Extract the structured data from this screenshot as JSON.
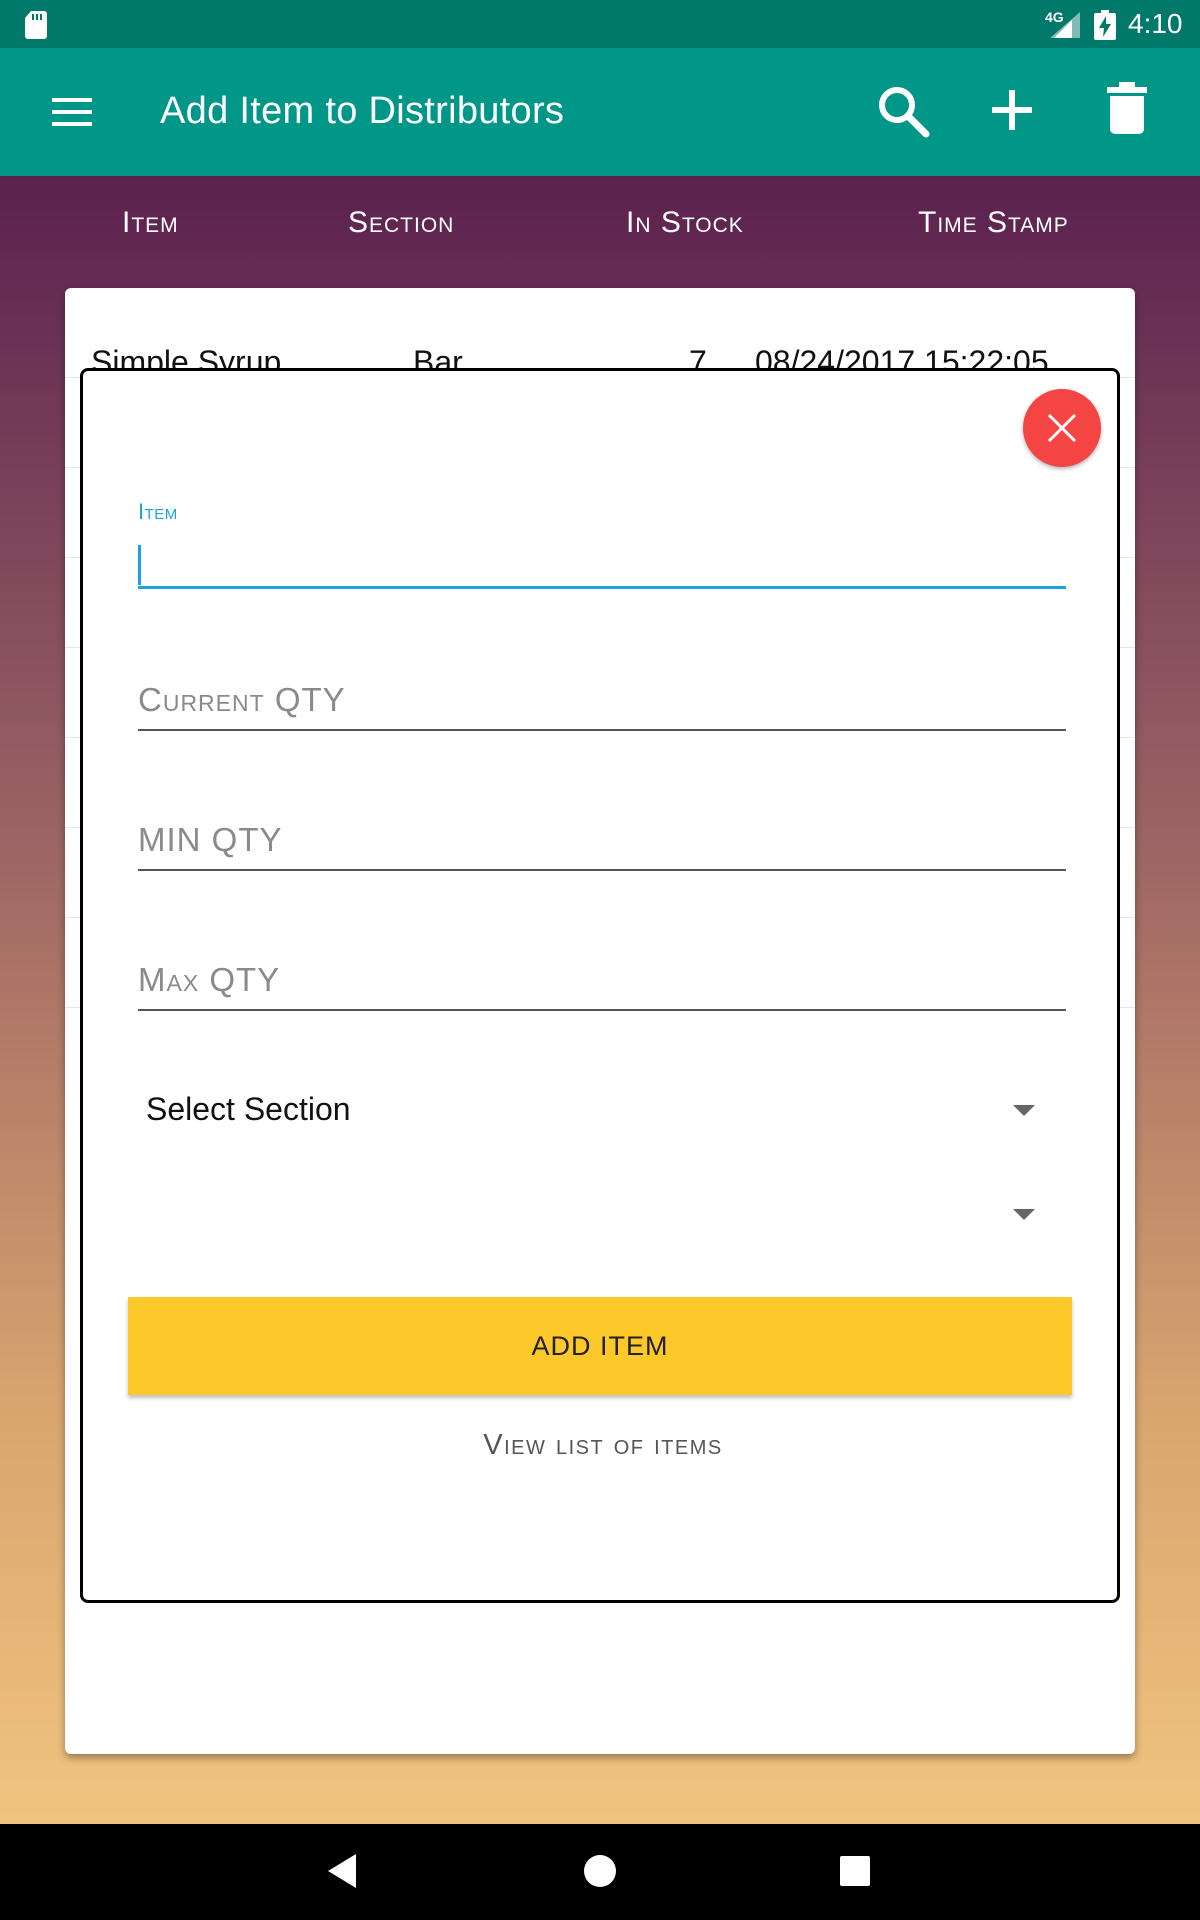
{
  "status_bar": {
    "network": "4G",
    "time": "4:10"
  },
  "app_bar": {
    "title": "Add Item to Distributors",
    "icons": [
      "menu-icon",
      "search-icon",
      "add-icon",
      "delete-icon"
    ]
  },
  "table": {
    "headers": {
      "item": "Item",
      "section": "Section",
      "in_stock": "In Stock",
      "time_stamp": "Time Stamp"
    },
    "rows": [
      {
        "item": "Simple Syrup",
        "section": "Bar",
        "in_stock": "7",
        "time_stamp": "08/24/2017 15:22:05"
      }
    ]
  },
  "dialog": {
    "item_label": "Item",
    "item_value": "",
    "current_qty_placeholder": "Current QTY",
    "min_qty_placeholder": "MIN QTY",
    "max_qty_placeholder": "Max QTY",
    "select_section_label": "Select Section",
    "second_select_label": "",
    "add_button_label": "ADD ITEM",
    "view_list_label": "View list of items"
  },
  "colors": {
    "app_bar": "#009688",
    "status_bar": "#00796b",
    "accent": "#1aa3e0",
    "button": "#fdc829",
    "close_button": "#f44444"
  }
}
